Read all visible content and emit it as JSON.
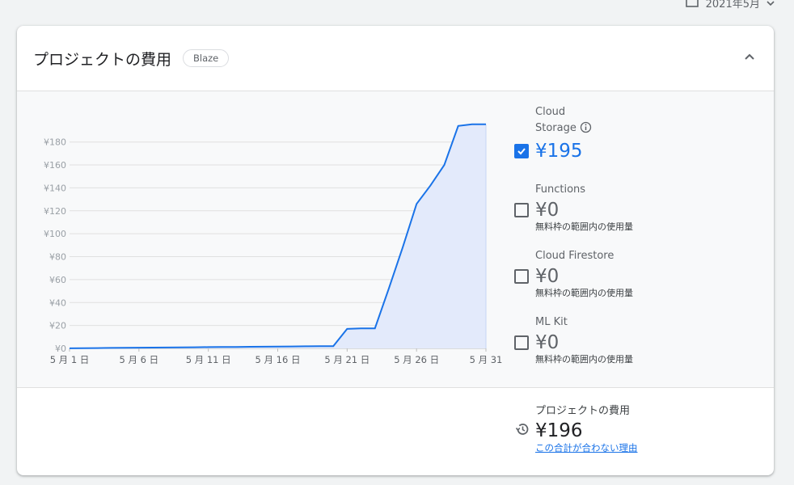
{
  "topbar": {
    "date_label": "2021年5月",
    "calendar_icon": "calendar-icon",
    "dropdown_icon": "chevron-down-icon"
  },
  "card": {
    "title": "プロジェクトの費用",
    "plan_badge": "Blaze",
    "collapse_icon": "chevron-up-icon"
  },
  "legend": {
    "items": [
      {
        "name_line1": "Cloud",
        "name_line2": "Storage",
        "value": "¥195",
        "checked": true,
        "note": "",
        "info_icon": "info-icon"
      },
      {
        "name_line1": "Functions",
        "name_line2": "",
        "value": "¥0",
        "checked": false,
        "note": "無料枠の範囲内の使用量"
      },
      {
        "name_line1": "Cloud Firestore",
        "name_line2": "",
        "value": "¥0",
        "checked": false,
        "note": "無料枠の範囲内の使用量"
      },
      {
        "name_line1": "ML Kit",
        "name_line2": "",
        "value": "¥0",
        "checked": false,
        "note": "無料枠の範囲内の使用量"
      }
    ]
  },
  "total": {
    "label": "プロジェクトの費用",
    "value": "¥196",
    "link": "この合計が合わない理由",
    "history_icon": "history-icon"
  },
  "colors": {
    "accent": "#1a73e8",
    "area_fill": "#e3eafb",
    "grid": "#e0e0e0"
  },
  "chart_data": {
    "type": "area",
    "series": [
      {
        "name": "Cloud Storage",
        "x": [
          1,
          2,
          3,
          4,
          5,
          6,
          7,
          8,
          9,
          10,
          11,
          12,
          13,
          14,
          15,
          16,
          17,
          18,
          19,
          20,
          21,
          22,
          23,
          24,
          25,
          26,
          27,
          28,
          29,
          30,
          31
        ],
        "values": [
          0.1,
          0.2,
          0.3,
          0.4,
          0.5,
          0.6,
          0.7,
          0.8,
          0.9,
          1.0,
          1.1,
          1.2,
          1.3,
          1.4,
          1.5,
          1.6,
          1.7,
          1.8,
          1.9,
          2.0,
          17,
          17.5,
          17.5,
          52,
          88,
          126,
          142,
          160,
          194,
          195.5,
          195.5
        ]
      }
    ],
    "x_ticks": [
      {
        "x": 1,
        "label": "5 月 1 日"
      },
      {
        "x": 6,
        "label": "5 月 6 日"
      },
      {
        "x": 11,
        "label": "5 月 11 日"
      },
      {
        "x": 16,
        "label": "5 月 16 日"
      },
      {
        "x": 21,
        "label": "5 月 21 日"
      },
      {
        "x": 26,
        "label": "5 月 26 日"
      },
      {
        "x": 31,
        "label": "5 月 31"
      }
    ],
    "y_ticks": [
      {
        "y": 0,
        "label": "¥0"
      },
      {
        "y": 20,
        "label": "¥20"
      },
      {
        "y": 40,
        "label": "¥40"
      },
      {
        "y": 60,
        "label": "¥60"
      },
      {
        "y": 80,
        "label": "¥80"
      },
      {
        "y": 100,
        "label": "¥100"
      },
      {
        "y": 120,
        "label": "¥120"
      },
      {
        "y": 140,
        "label": "¥140"
      },
      {
        "y": 160,
        "label": "¥160"
      },
      {
        "y": 180,
        "label": "¥180"
      }
    ],
    "xlim": [
      1,
      31
    ],
    "ylim": [
      0,
      196
    ],
    "grid": true,
    "legend": "right"
  }
}
